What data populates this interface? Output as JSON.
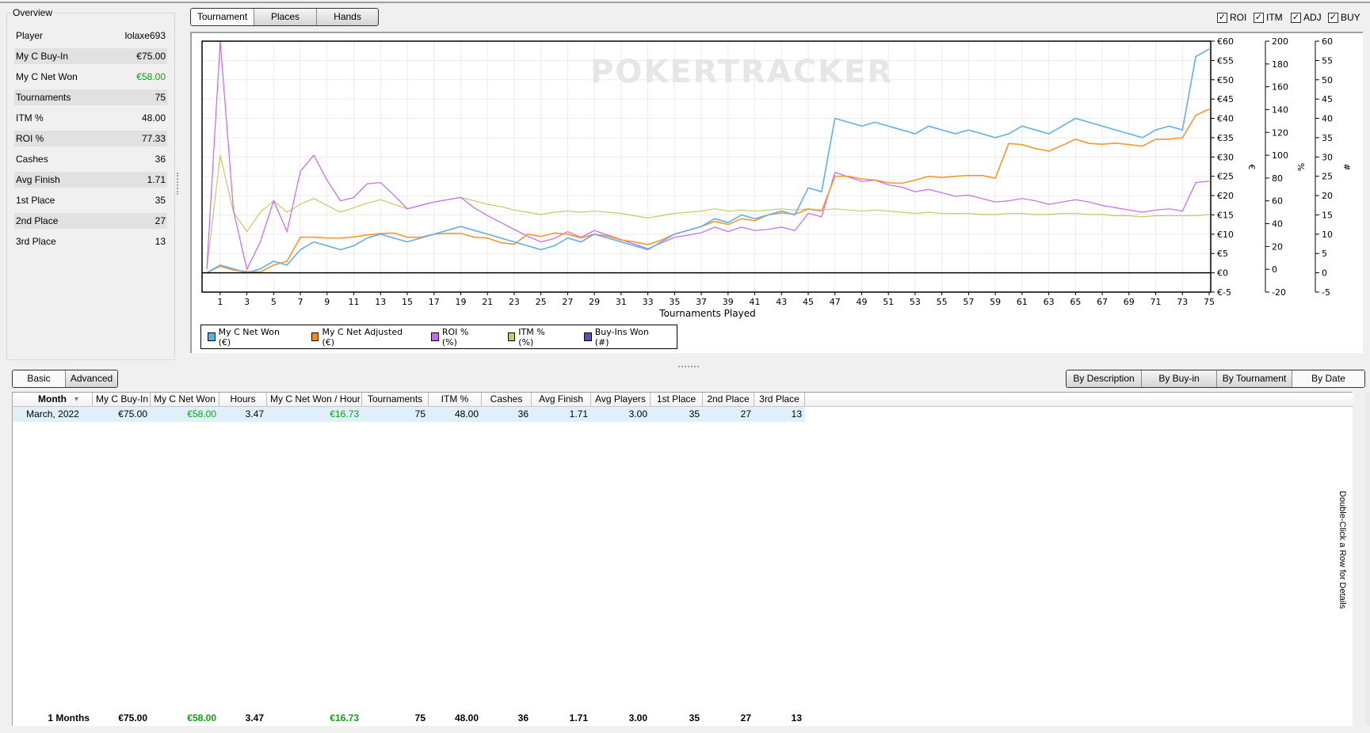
{
  "overview": {
    "title": "Overview",
    "rows": [
      {
        "label": "Player",
        "value": "lolaxe693"
      },
      {
        "label": "My C Buy-In",
        "value": "€75.00"
      },
      {
        "label": "My C Net Won",
        "value": "€58.00"
      },
      {
        "label": "Tournaments",
        "value": "75"
      },
      {
        "label": "ITM %",
        "value": "48.00"
      },
      {
        "label": "ROI %",
        "value": "77.33"
      },
      {
        "label": "Cashes",
        "value": "36"
      },
      {
        "label": "Avg Finish",
        "value": "1.71"
      },
      {
        "label": "1st Place",
        "value": "35"
      },
      {
        "label": "2nd Place",
        "value": "27"
      },
      {
        "label": "3rd Place",
        "value": "13"
      }
    ]
  },
  "view_tabs": [
    "Tournament",
    "Places",
    "Hands"
  ],
  "series_toggles": [
    {
      "label": "ROI",
      "checked": true
    },
    {
      "label": "ITM",
      "checked": true
    },
    {
      "label": "ADJ",
      "checked": true
    },
    {
      "label": "BUY",
      "checked": true
    }
  ],
  "watermark": "POKERTRACKER",
  "chart_data": {
    "type": "line",
    "xlabel": "Tournaments Played",
    "x_ticks": [
      1,
      3,
      5,
      7,
      9,
      11,
      13,
      15,
      17,
      19,
      21,
      23,
      25,
      27,
      29,
      31,
      33,
      35,
      37,
      39,
      41,
      43,
      45,
      47,
      49,
      51,
      53,
      55,
      57,
      59,
      61,
      63,
      65,
      67,
      69,
      71,
      73,
      75
    ],
    "xlim": [
      0,
      75
    ],
    "axes": [
      {
        "id": "eur",
        "title": "€",
        "ylim": [
          -5,
          60
        ],
        "ticks": [
          "€-5",
          "€0",
          "€5",
          "€10",
          "€15",
          "€20",
          "€25",
          "€30",
          "€35",
          "€40",
          "€45",
          "€50",
          "€55",
          "€60"
        ],
        "tick_values": [
          -5,
          0,
          5,
          10,
          15,
          20,
          25,
          30,
          35,
          40,
          45,
          50,
          55,
          60
        ]
      },
      {
        "id": "pct",
        "title": "%",
        "ylim": [
          -20,
          200
        ],
        "ticks": [
          "-20",
          "0",
          "20",
          "40",
          "60",
          "80",
          "100",
          "120",
          "140",
          "160",
          "180",
          "200"
        ],
        "tick_values": [
          -20,
          0,
          20,
          40,
          60,
          80,
          100,
          120,
          140,
          160,
          180,
          200
        ]
      },
      {
        "id": "num",
        "title": "#",
        "ylim": [
          -5,
          60
        ],
        "ticks": [
          "-5",
          "0",
          "5",
          "10",
          "15",
          "20",
          "25",
          "30",
          "35",
          "40",
          "45",
          "50",
          "55",
          "60"
        ],
        "tick_values": [
          -5,
          0,
          5,
          10,
          15,
          20,
          25,
          30,
          35,
          40,
          45,
          50,
          55,
          60
        ]
      }
    ],
    "grid": true,
    "legend_position": "bottom-left",
    "series": [
      {
        "name": "Buy-Ins Won (#)",
        "axis": "num",
        "color": "#5050c0",
        "values": [
          0,
          2,
          1,
          0,
          1,
          3,
          2,
          6,
          8,
          7,
          6,
          7,
          9,
          10,
          9,
          8,
          9,
          10,
          11,
          12,
          11,
          10,
          9,
          8,
          7,
          6,
          7,
          9,
          8,
          10,
          9,
          8,
          7,
          6,
          8,
          10,
          11,
          12,
          14,
          13,
          15,
          14,
          15,
          16,
          15,
          22,
          21,
          40,
          39,
          38,
          39,
          38,
          37,
          36,
          38,
          37,
          36,
          37,
          36,
          35,
          36,
          38,
          37,
          36,
          38,
          40,
          39,
          38,
          37,
          36,
          35,
          37,
          38,
          37,
          56,
          58
        ]
      },
      {
        "name": "ITM % (%)",
        "axis": "pct",
        "color": "#c8c864",
        "values": [
          0,
          100,
          50,
          33,
          50,
          60,
          50,
          57,
          62,
          56,
          50,
          54,
          58,
          61,
          57,
          53,
          56,
          59,
          61,
          63,
          60,
          57,
          55,
          52,
          50,
          48,
          50,
          51,
          50,
          51,
          50,
          49,
          47,
          45,
          47,
          49,
          50,
          51,
          53,
          51,
          52,
          51,
          52,
          53,
          52,
          53,
          52,
          53,
          52,
          51,
          52,
          51,
          50,
          49,
          50,
          49,
          49,
          49,
          48,
          48,
          49,
          49,
          48,
          48,
          49,
          49,
          48,
          48,
          47,
          47,
          46,
          47,
          47,
          47,
          47,
          48
        ]
      },
      {
        "name": "ROI % (%)",
        "axis": "pct",
        "color": "#c864ff",
        "values": [
          0,
          200,
          51,
          0,
          24,
          60,
          33,
          86,
          100,
          78,
          60,
          63,
          75,
          76,
          65,
          53,
          56,
          59,
          61,
          63,
          54,
          47,
          41,
          35,
          29,
          24,
          27,
          33,
          28,
          34,
          30,
          26,
          22,
          18,
          23,
          28,
          30,
          32,
          37,
          33,
          37,
          34,
          35,
          37,
          34,
          49,
          46,
          85,
          81,
          77,
          78,
          74,
          72,
          68,
          70,
          67,
          64,
          65,
          62,
          59,
          60,
          62,
          60,
          57,
          59,
          61,
          59,
          56,
          54,
          52,
          50,
          52,
          53,
          51,
          76,
          77.33
        ]
      },
      {
        "name": "My C Net Adjusted (€)",
        "axis": "eur",
        "color": "#ff9628",
        "values": [
          0,
          1.7,
          0.7,
          0.3,
          0.2,
          2,
          3,
          9.2,
          9.2,
          9,
          9,
          9.3,
          9.8,
          10.2,
          10.3,
          9.2,
          9.2,
          10,
          10.2,
          10.2,
          9.2,
          9,
          7.8,
          7.4,
          10,
          9.4,
          10.3,
          10,
          9,
          10,
          9.5,
          8.5,
          8,
          7.3,
          8.5,
          10,
          11,
          12,
          13.3,
          12.5,
          14,
          13.5,
          15,
          15.5,
          15.2,
          16.5,
          16,
          25,
          25,
          24.3,
          24,
          23.3,
          23.2,
          24,
          25,
          24.7,
          25,
          25.2,
          25.2,
          24.5,
          33.5,
          33.2,
          32.2,
          31.5,
          33,
          34.6,
          33.5,
          33.3,
          33.6,
          33.2,
          32.8,
          34.6,
          34.6,
          35,
          40.8,
          42.4
        ]
      },
      {
        "name": "My C Net Won (€)",
        "axis": "eur",
        "color": "#64b4f0",
        "values": [
          0,
          2,
          1,
          0,
          1,
          3,
          2,
          6,
          8,
          7,
          6,
          7,
          9,
          10,
          9,
          8,
          9,
          10,
          11,
          12,
          11,
          10,
          9,
          8,
          7,
          6,
          7,
          9,
          8,
          10,
          9,
          8,
          7,
          6,
          8,
          10,
          11,
          12,
          14,
          13,
          15,
          14,
          15,
          16,
          15,
          22,
          21,
          40,
          39,
          38,
          39,
          38,
          37,
          36,
          38,
          37,
          36,
          37,
          36,
          35,
          36,
          38,
          37,
          36,
          38,
          40,
          39,
          38,
          37,
          36,
          35,
          37,
          38,
          37,
          56,
          58
        ]
      }
    ],
    "legend": [
      {
        "label": "My C Net Won (€)",
        "color": "#50b4f0"
      },
      {
        "label": "My C Net Adjusted (€)",
        "color": "#ff8c00"
      },
      {
        "label": "ROI % (%)",
        "color": "#c864ff"
      },
      {
        "label": "ITM % (%)",
        "color": "#c8c864"
      },
      {
        "label": "Buy-Ins Won (#)",
        "color": "#5050c0"
      }
    ]
  },
  "mode_tabs": [
    "Basic",
    "Advanced"
  ],
  "group_tabs": [
    "By Description",
    "By Buy-in",
    "By Tournament",
    "By Date"
  ],
  "table": {
    "columns": [
      "Month",
      "My C Buy-In",
      "My C Net Won",
      "Hours",
      "My C Net Won / Hour",
      "Tournaments",
      "ITM %",
      "Cashes",
      "Avg Finish",
      "Avg Players",
      "1st Place",
      "2nd Place",
      "3rd Place"
    ],
    "rows": [
      [
        "March, 2022",
        "€75.00",
        "€58.00",
        "3.47",
        "€16.73",
        "75",
        "48.00",
        "36",
        "1.71",
        "3.00",
        "35",
        "27",
        "13"
      ]
    ],
    "totals": [
      "1 Months",
      "€75.00",
      "€58.00",
      "3.47",
      "€16.73",
      "75",
      "48.00",
      "36",
      "1.71",
      "3.00",
      "35",
      "27",
      "13"
    ],
    "hint": "Double-Click a Row for Details"
  }
}
